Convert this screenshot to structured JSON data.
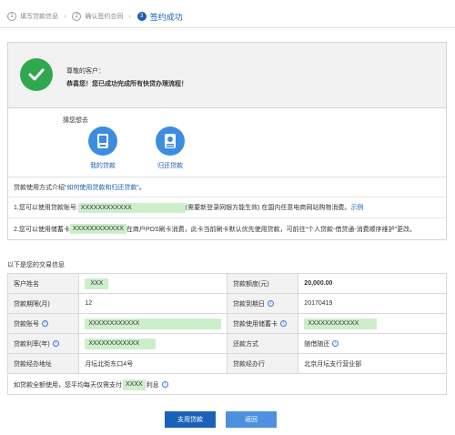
{
  "steps": [
    {
      "num": "1",
      "label": "填写贷款信息",
      "sep": "›"
    },
    {
      "num": "2",
      "label": "确认签约合同",
      "sep": "›"
    },
    {
      "num": "3",
      "label": "签约成功",
      "sep": ""
    }
  ],
  "success": {
    "greeting": "尊敬的客户：",
    "message": "恭喜您！您已成功完成所有快贷办理流程！"
  },
  "guess": {
    "title": "猜您想去",
    "items": [
      {
        "label": "我的贷款",
        "icon": "my-loan-icon"
      },
      {
        "label": "归还贷款",
        "icon": "repay-loan-icon"
      }
    ]
  },
  "info": {
    "intro_prefix": "贷款使用方式介绍",
    "intro_link": "“如何使用贷款和归还贷款”",
    "intro_suffix": "。",
    "line1_prefix": "1.您可以使用贷款账号:",
    "line1_account": "XXXXXXXXXXXX",
    "line1_middle": "(需要新登录网银方能生效) 在国内任意电商网站购物消费。",
    "line1_link": "示例",
    "line2_prefix": "2.您可以使用储蓄卡",
    "line2_card": "XXXXXXXXXXXX",
    "line2_suffix": "在商户POS刷卡消费，此卡当前刷卡默认优先使用贷款，可前往“个人贷款-借贷通-消费顺序维护”更改。"
  },
  "transaction": {
    "title": "以下是您的交易信息",
    "rows": [
      {
        "k1": "客户姓名",
        "v1": "XXX",
        "k2": "贷款额度(元)",
        "v2": "20,000.00"
      },
      {
        "k1": "贷款期限(月)",
        "v1": "12",
        "k2": "贷款到期日",
        "v2": "20170419"
      },
      {
        "k1": "贷款账号",
        "v1": "XXXXXXXXXXXX",
        "k2": "贷款使用储蓄卡",
        "v2": "XXXXXXXXXXXX"
      },
      {
        "k1": "贷款利率(年)",
        "v1": "XXXXXXXXXXXX",
        "k2": "还款方式",
        "v2": "随借随还"
      },
      {
        "k1": "贷款经办地址",
        "v1": "月坛北街东口4号",
        "k2": "贷款经办行",
        "v2": "北京月坛支行营业部"
      }
    ],
    "footer_prefix": "如贷款全额使用，您平均每天仅需支付",
    "footer_amount": "XXXX",
    "footer_suffix": "利息"
  },
  "buttons": {
    "use_loan": "支用贷款",
    "back": "返回"
  },
  "colors": {
    "primary": "#1a62b8",
    "secondary": "#4d90df",
    "success": "#2fa84f",
    "amount": "#d0241a",
    "highlight": "#cdeecb"
  }
}
